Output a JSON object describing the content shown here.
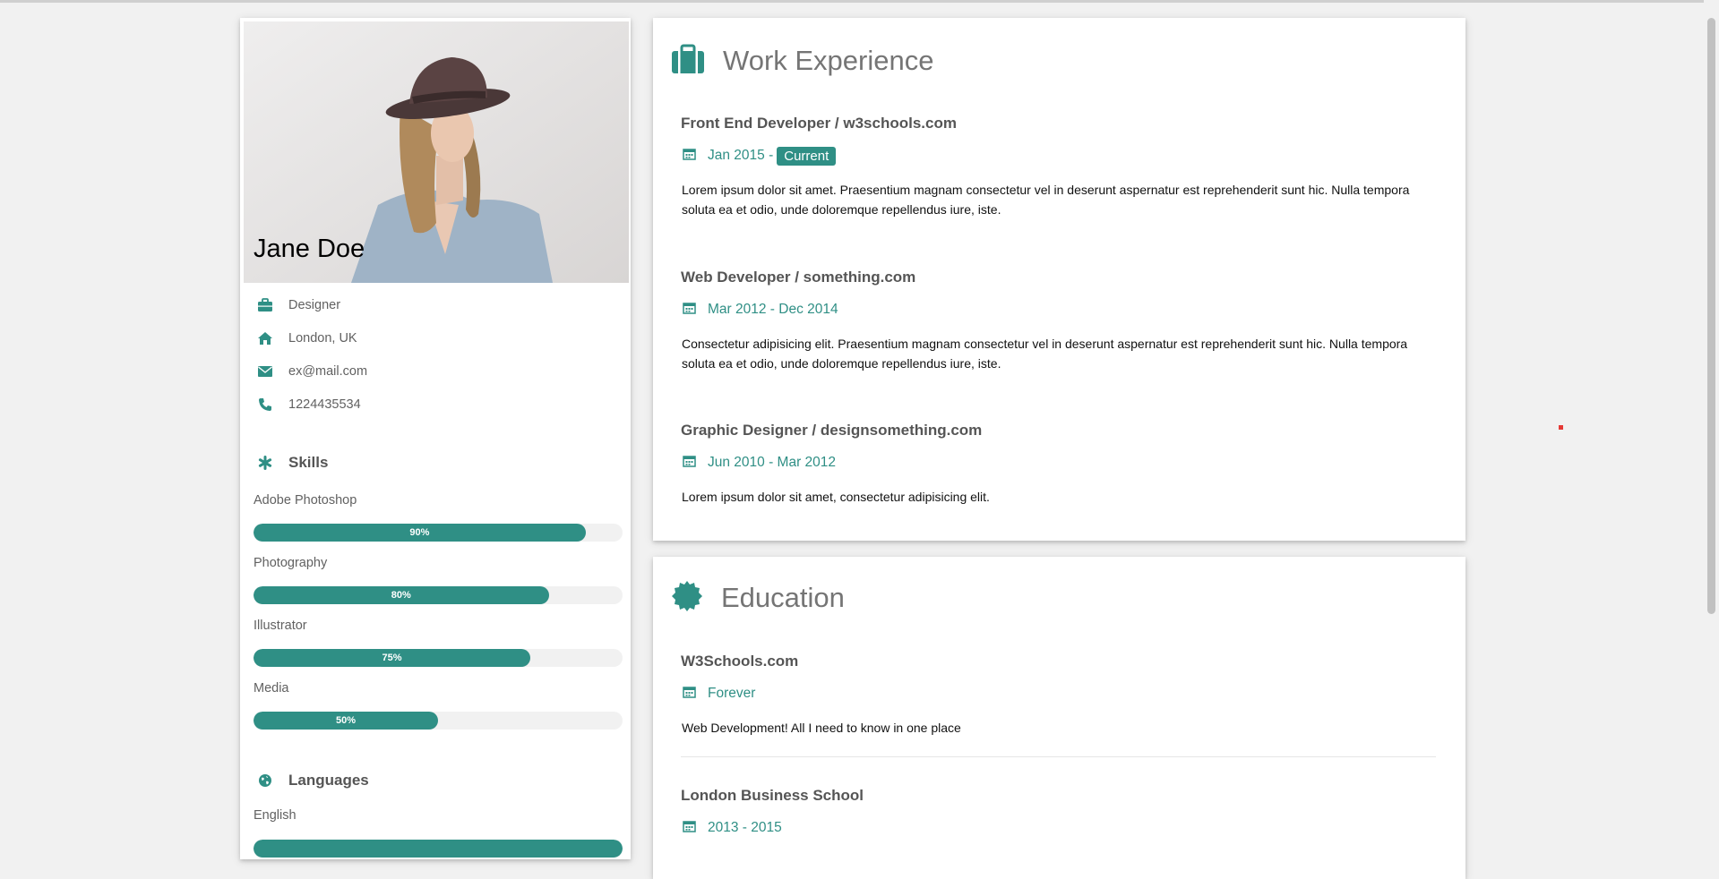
{
  "profile": {
    "name": "Jane Doe",
    "info": [
      {
        "icon": "briefcase-icon",
        "text": "Designer"
      },
      {
        "icon": "home-icon",
        "text": "London, UK"
      },
      {
        "icon": "envelope-icon",
        "text": "ex@mail.com"
      },
      {
        "icon": "phone-icon",
        "text": "1224435534"
      }
    ]
  },
  "skills": {
    "title": "Skills",
    "items": [
      {
        "label": "Adobe Photoshop",
        "percent": 90,
        "percent_text": "90%"
      },
      {
        "label": "Photography",
        "percent": 80,
        "percent_text": "80%"
      },
      {
        "label": "Illustrator",
        "percent": 75,
        "percent_text": "75%"
      },
      {
        "label": "Media",
        "percent": 50,
        "percent_text": "50%"
      }
    ]
  },
  "languages": {
    "title": "Languages",
    "items": [
      {
        "label": "English",
        "percent": 100
      }
    ]
  },
  "work": {
    "title": "Work Experience",
    "jobs": [
      {
        "title": "Front End Developer / w3schools.com",
        "date": "Jan 2015 -",
        "badge": "Current",
        "desc": "Lorem ipsum dolor sit amet. Praesentium magnam consectetur vel in deserunt aspernatur est reprehenderit sunt hic. Nulla tempora soluta ea et odio, unde doloremque repellendus iure, iste."
      },
      {
        "title": "Web Developer / something.com",
        "date": "Mar 2012 - Dec 2014",
        "badge": "",
        "desc": "Consectetur adipisicing elit. Praesentium magnam consectetur vel in deserunt aspernatur est reprehenderit sunt hic. Nulla tempora soluta ea et odio, unde doloremque repellendus iure, iste."
      },
      {
        "title": "Graphic Designer / designsomething.com",
        "date": "Jun 2010 - Mar 2012",
        "badge": "",
        "desc": "Lorem ipsum dolor sit amet, consectetur adipisicing elit."
      }
    ]
  },
  "education": {
    "title": "Education",
    "items": [
      {
        "school": "W3Schools.com",
        "date": "Forever",
        "desc": "Web Development! All I need to know in one place"
      },
      {
        "school": "London Business School",
        "date": "2013 - 2015"
      }
    ]
  },
  "colors": {
    "accent": "#2f8f85",
    "background": "#f1f1f1"
  }
}
